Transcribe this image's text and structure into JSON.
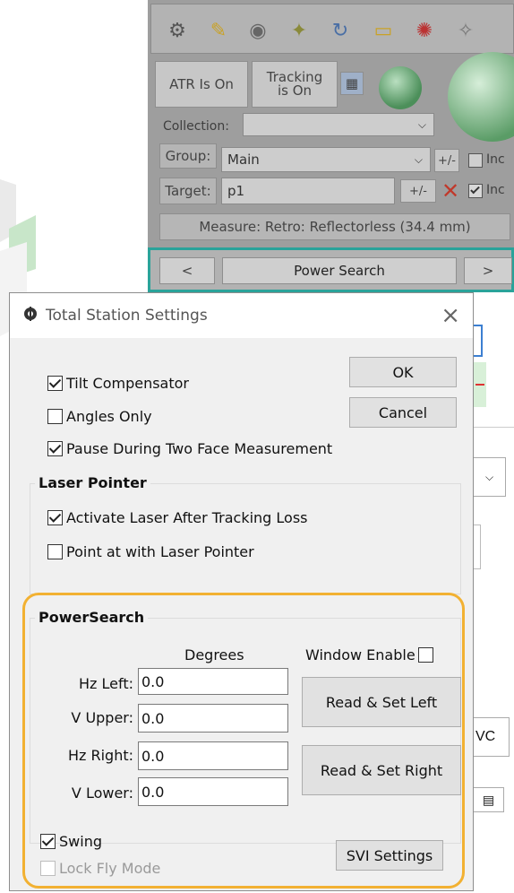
{
  "app": {
    "toolbar_icons": [
      "gear-icon",
      "pencil-icon",
      "target-icon",
      "satellite-icon",
      "refresh-icon",
      "folder-icon",
      "laser-icon",
      "sparkle-icon"
    ],
    "atr_button": "ATR Is On",
    "tracking_button": "Tracking is On",
    "collection_label": "Collection:",
    "collection_value": "",
    "group_label": "Group:",
    "group_value": "Main",
    "group_plusminus": "+/-",
    "target_label": "Target:",
    "target_value": "p1",
    "target_plusminus": "+/-",
    "include_label_1": "Inc",
    "include_label_2": "Inc",
    "measure_text": "Measure: Retro: Reflectorless (34.4 mm)",
    "prev_button": "<",
    "power_search_button": "Power Search",
    "next_button": ">",
    "partial_vc": "VC"
  },
  "dialog": {
    "title": "Total Station Settings",
    "close_label": "×",
    "ok_button": "OK",
    "cancel_button": "Cancel",
    "options": {
      "tilt_compensator": {
        "label": "Tilt Compensator",
        "checked": true
      },
      "angles_only": {
        "label": "Angles Only",
        "checked": false
      },
      "pause_two_face": {
        "label": "Pause During Two Face Measurement",
        "checked": true
      }
    },
    "laser_pointer": {
      "title": "Laser Pointer",
      "activate_after_loss": {
        "label": "Activate Laser After Tracking Loss",
        "checked": true
      },
      "point_at_with_laser": {
        "label": "Point at with Laser Pointer",
        "checked": false
      }
    },
    "power_search": {
      "title": "PowerSearch",
      "degrees_header": "Degrees",
      "window_enable_label": "Window Enable",
      "window_enable_checked": false,
      "hz_left_label": "Hz Left:",
      "hz_left_value": "0.0",
      "v_upper_label": "V Upper:",
      "v_upper_value": "0.0",
      "hz_right_label": "Hz Right:",
      "hz_right_value": "0.0",
      "v_lower_label": "V Lower:",
      "v_lower_value": "0.0",
      "read_set_left": "Read & Set Left",
      "read_set_right": "Read & Set Right",
      "swing_label": "Swing",
      "swing_checked": true,
      "lock_fly_label": "Lock Fly Mode",
      "lock_fly_checked": false,
      "svi_settings": "SVI Settings"
    }
  },
  "colors": {
    "highlight_orange": "#f2b132",
    "highlight_teal": "#2aa39a"
  }
}
